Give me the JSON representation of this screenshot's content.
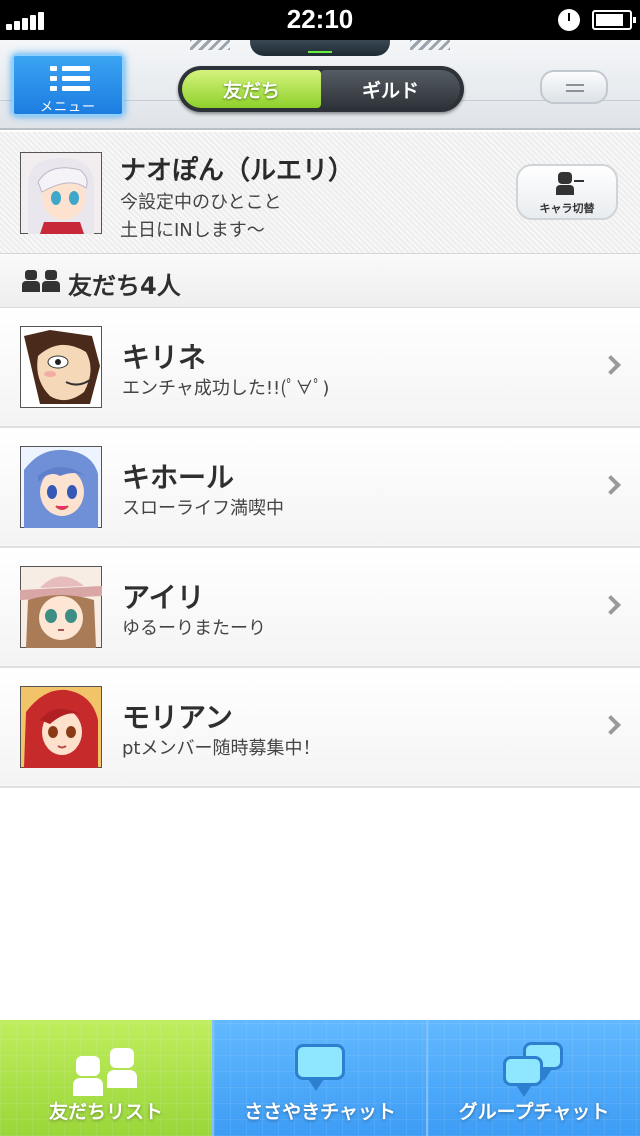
{
  "status_bar": {
    "time": "22:10",
    "signal_bars": 5,
    "battery_level": 0.85
  },
  "header": {
    "menu_label": "メニュー",
    "tabs": [
      {
        "label": "友だち",
        "active": true
      },
      {
        "label": "ギルド",
        "active": false
      }
    ],
    "accent_color": "#8ed02c"
  },
  "profile": {
    "name": "ナオぽん（ルエリ）",
    "status_line1": "今設定中のひとこと",
    "status_line2": "土日にINします〜",
    "switch_button_label": "キャラ切替"
  },
  "friends": {
    "heading": "友だち4人",
    "items": [
      {
        "name": "キリネ",
        "status": "エンチャ成功した!!(ﾟ∀ﾟ)",
        "avatar_icon": "wolf-avatar"
      },
      {
        "name": "キホール",
        "status": "スローライフ満喫中",
        "avatar_icon": "blue-hair-girl-avatar"
      },
      {
        "name": "アイリ",
        "status": "ゆるーりまたーり",
        "avatar_icon": "hat-girl-avatar"
      },
      {
        "name": "モリアン",
        "status": "ptメンバー随時募集中！",
        "avatar_icon": "red-hair-girl-avatar"
      }
    ]
  },
  "tabbar": {
    "tabs": [
      {
        "label": "友だちリスト",
        "icon": "friends-icon",
        "active": true
      },
      {
        "label": "ささやきチャット",
        "icon": "chat-bubble-icon",
        "active": false
      },
      {
        "label": "グループチャット",
        "icon": "group-chat-icon",
        "active": false
      }
    ],
    "active_color": "#9ad63a",
    "inactive_color": "#3d9cf5"
  }
}
